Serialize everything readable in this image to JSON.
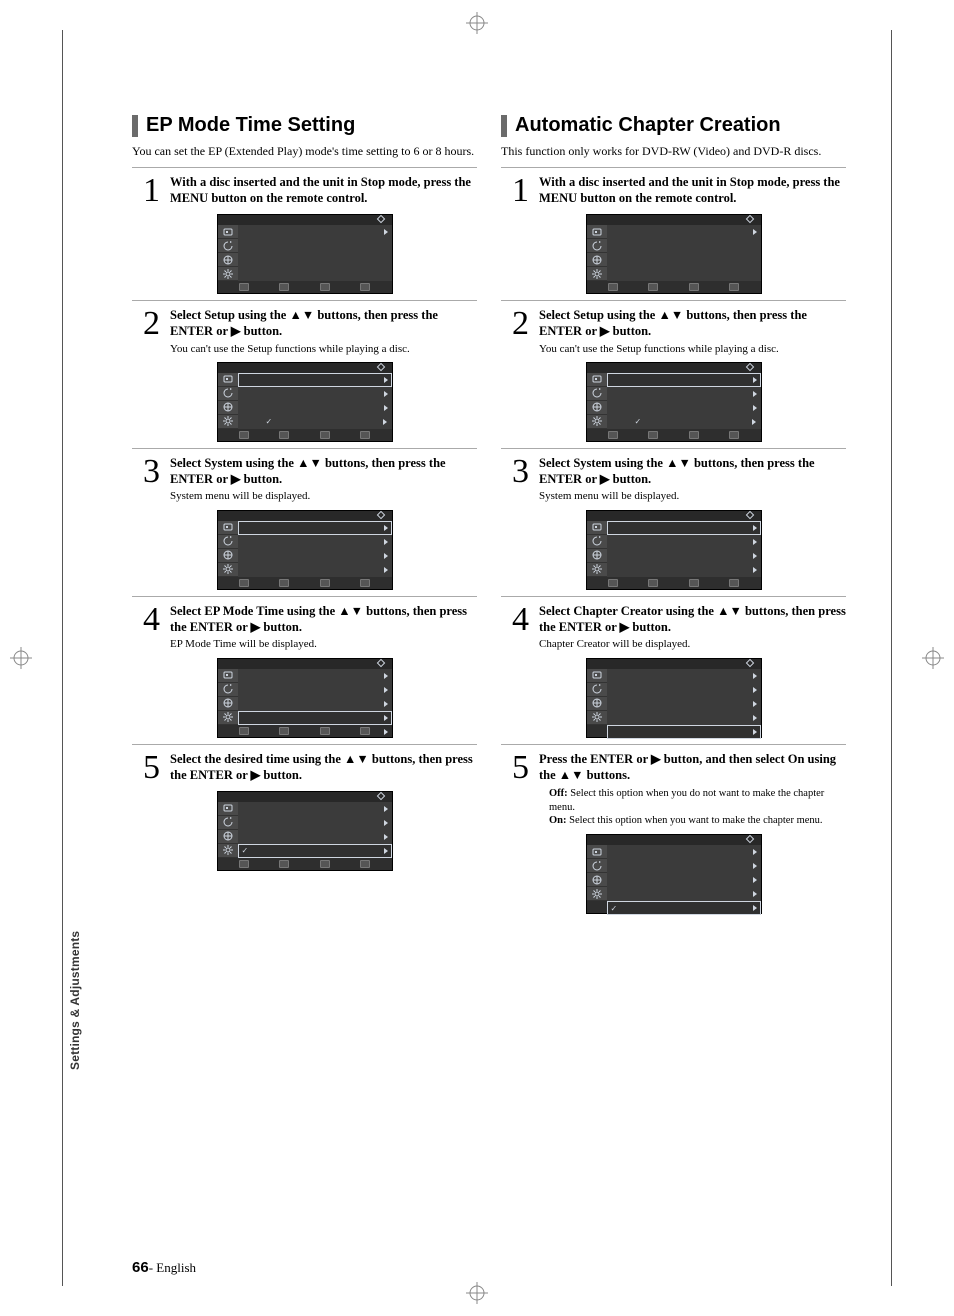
{
  "domain": "Document",
  "page_number": "66",
  "page_locale": "English",
  "side_tab": "Settings & Adjustments",
  "glyph": {
    "up": "▲",
    "down": "▼",
    "right": "▶"
  },
  "left": {
    "heading": "EP Mode Time Setting",
    "intro": "You can set the EP (Extended Play) mode's time setting to 6 or 8 hours.",
    "steps": [
      {
        "n": "1",
        "lead": "With a disc inserted and the unit in Stop mode, press the MENU button on the remote control.",
        "note": null,
        "osd": {
          "rows": [
            {
              "tri": true
            }
          ]
        }
      },
      {
        "n": "2",
        "lead": "Select Setup using the ▲▼ buttons, then press the ENTER or ▶ button.",
        "note": "You can't use the Setup functions while playing a disc.",
        "osd": {
          "rows": [
            {
              "sel": true,
              "tri": true
            },
            {
              "tri": true
            },
            {
              "tri": true
            },
            {
              "glyph": "✓",
              "tri": true
            }
          ]
        }
      },
      {
        "n": "3",
        "lead": "Select System using the ▲▼ buttons, then press the ENTER or ▶ button.",
        "note": "System menu will be displayed.",
        "osd": {
          "rows": [
            {
              "sel": true,
              "tri": true
            },
            {
              "tri": true
            },
            {
              "tri": true
            },
            {
              "tri": true
            }
          ]
        }
      },
      {
        "n": "4",
        "lead": "Select EP Mode Time using the ▲▼ buttons, then press the ENTER or ▶ button.",
        "note": "EP Mode Time will be displayed.",
        "osd": {
          "rows": [
            {
              "tri": true
            },
            {
              "tri": true
            },
            {
              "tri": true
            },
            {
              "sel": true,
              "tri": true
            },
            {
              "tri": true
            }
          ]
        }
      },
      {
        "n": "5",
        "lead": "Select the desired time using the ▲▼ buttons, then press the ENTER or ▶ button.",
        "note": null,
        "osd": {
          "rows": [
            {
              "tri": true
            },
            {
              "tri": true
            },
            {
              "tri": true
            },
            {
              "sel": true,
              "chk": "✓",
              "tri": true
            }
          ]
        }
      }
    ]
  },
  "right": {
    "heading": "Automatic Chapter Creation",
    "intro": "This function only works for DVD-RW (Video) and DVD-R discs.",
    "steps": [
      {
        "n": "1",
        "lead": "With a disc inserted and the unit in Stop mode, press the MENU button on the remote control.",
        "note": null,
        "osd": {
          "rows": [
            {
              "tri": true
            }
          ]
        }
      },
      {
        "n": "2",
        "lead": "Select Setup using the ▲▼ buttons, then press the ENTER or ▶ button.",
        "note": "You can't use the Setup functions while playing a disc.",
        "osd": {
          "rows": [
            {
              "sel": true,
              "tri": true
            },
            {
              "tri": true
            },
            {
              "tri": true
            },
            {
              "glyph": "✓",
              "tri": true
            }
          ]
        }
      },
      {
        "n": "3",
        "lead": "Select System using the ▲▼ buttons, then press the ENTER or ▶ button.",
        "note": "System menu will be displayed.",
        "osd": {
          "rows": [
            {
              "sel": true,
              "tri": true
            },
            {
              "tri": true
            },
            {
              "tri": true
            },
            {
              "tri": true
            }
          ]
        }
      },
      {
        "n": "4",
        "lead": "Select Chapter Creator using the ▲▼ buttons, then press the ENTER or ▶ button.",
        "note": "Chapter Creator will be displayed.",
        "osd": {
          "rows": [
            {
              "tri": true
            },
            {
              "tri": true
            },
            {
              "tri": true
            },
            {
              "tri": true
            },
            {
              "sel": true,
              "tri": true
            }
          ]
        }
      },
      {
        "n": "5",
        "lead": "Press the ENTER or ▶ button, and then select On using the ▲▼ buttons.",
        "note": null,
        "opts": [
          {
            "k": "Off:",
            "v": "Select this option when you do not want to make the chapter menu."
          },
          {
            "k": "On:",
            "v": "Select this option when you want to make the chapter menu."
          }
        ],
        "osd": {
          "rows": [
            {
              "tri": true
            },
            {
              "tri": true
            },
            {
              "tri": true
            },
            {
              "tri": true
            },
            {
              "sel": true,
              "chk": "✓",
              "tri": true
            }
          ]
        }
      }
    ]
  }
}
